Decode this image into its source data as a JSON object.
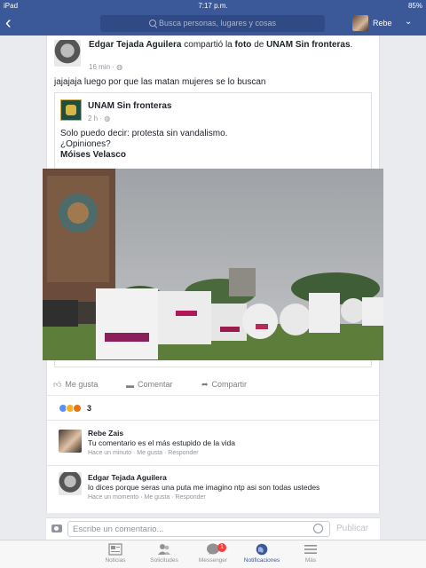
{
  "status_bar": {
    "device": "iPad",
    "time": "7:17 p.m.",
    "battery": "85%"
  },
  "nav": {
    "search_placeholder": "Busca personas, lugares y cosas",
    "user_name": "Rebe"
  },
  "post": {
    "author": "Edgar Tejada Aguilera",
    "action": "compartió la",
    "object": "foto",
    "connector": "de",
    "shared_from": "UNAM Sin fronteras",
    "time": "16 min",
    "text": "jajajaja luego por que las matan mujeres se lo buscan"
  },
  "shared": {
    "page_name": "UNAM Sin fronteras",
    "time": "2 h",
    "text_line1": "Solo puedo decir: protesta sin vandalismo.",
    "text_line2": "¿Opiniones?",
    "author": "Móises Velasco"
  },
  "actions": {
    "like": "Me gusta",
    "comment": "Comentar",
    "share": "Compartir"
  },
  "reactions": {
    "count": "3",
    "colors": [
      "#5890ff",
      "#f7b125",
      "#e9710f"
    ]
  },
  "comments": [
    {
      "name": "Rebe Zais",
      "text": "Tu comentario es el más estupido de la vida",
      "time": "Hace un minuto",
      "like": "Me gusta",
      "reply": "Responder"
    },
    {
      "name": "Edgar Tejada Aguilera",
      "text": "lo dices porque seras una puta me imagino ntp asi son todas ustedes",
      "time": "Hace un momento",
      "like": "Me gusta",
      "reply": "Responder"
    }
  ],
  "composer": {
    "placeholder": "Escribe un comentario...",
    "publish": "Publicar"
  },
  "tabs": [
    {
      "label": "Noticias",
      "icon": "news-feed-icon"
    },
    {
      "label": "Solicitudes",
      "icon": "friend-requests-icon"
    },
    {
      "label": "Messenger",
      "icon": "messenger-icon",
      "badge": "1"
    },
    {
      "label": "Notificaciones",
      "icon": "globe-icon",
      "active": true
    },
    {
      "label": "Más",
      "icon": "menu-icon"
    }
  ],
  "colors": {
    "brand": "#3b5998",
    "background": "#e9ebee",
    "badge": "#fa3e3e"
  }
}
